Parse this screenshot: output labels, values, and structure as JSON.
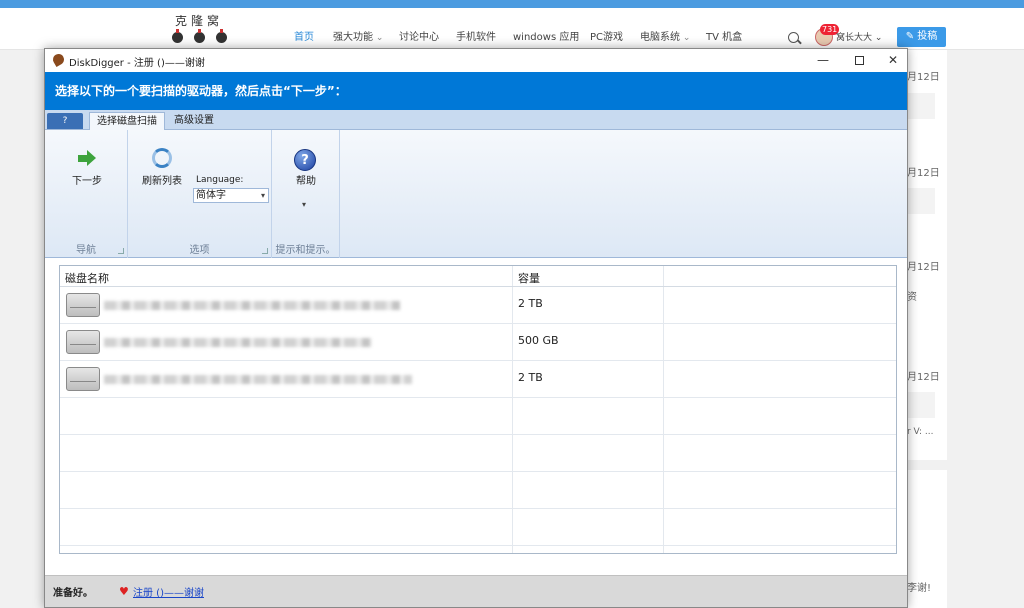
{
  "site": {
    "logo_text": "克隆窝",
    "nav": [
      "首页",
      "强大功能",
      "讨论中心",
      "手机软件",
      "windows 应用",
      "PC游戏",
      "电脑系统",
      "TV 机盒"
    ],
    "badge_count": "731",
    "username": "窝长大大",
    "post_button": "投稿",
    "right_dates": [
      "月12日",
      "月12日",
      "月12日",
      "月12日"
    ],
    "right_snippets": [
      "资",
      "r V: ...",
      "李谢!"
    ]
  },
  "window": {
    "title": "DiskDigger - 注册 ()——谢谢",
    "controls": {
      "minimize": "—",
      "close": "✕"
    },
    "banner": "选择以下的一个要扫描的驱动器，然后点击“下一步”：",
    "ribbon": {
      "app_button": "?",
      "tabs": [
        "选择磁盘扫描",
        "高级设置"
      ],
      "groups": {
        "nav": {
          "label": "导航",
          "next_button": "下一步"
        },
        "options": {
          "label": "选项",
          "refresh_button": "刷新列表",
          "language_label": "Language:",
          "language_value": "简体字"
        },
        "help": {
          "label": "提示和提示。",
          "help_button": "帮助",
          "more": "▾"
        }
      }
    },
    "table": {
      "headers": {
        "name": "磁盘名称",
        "size": "容量"
      },
      "rows": [
        {
          "size": "2 TB"
        },
        {
          "size": "500 GB"
        },
        {
          "size": "2 TB"
        }
      ]
    },
    "status": {
      "ready": "准备好。",
      "link": "注册 ()——谢谢"
    }
  }
}
